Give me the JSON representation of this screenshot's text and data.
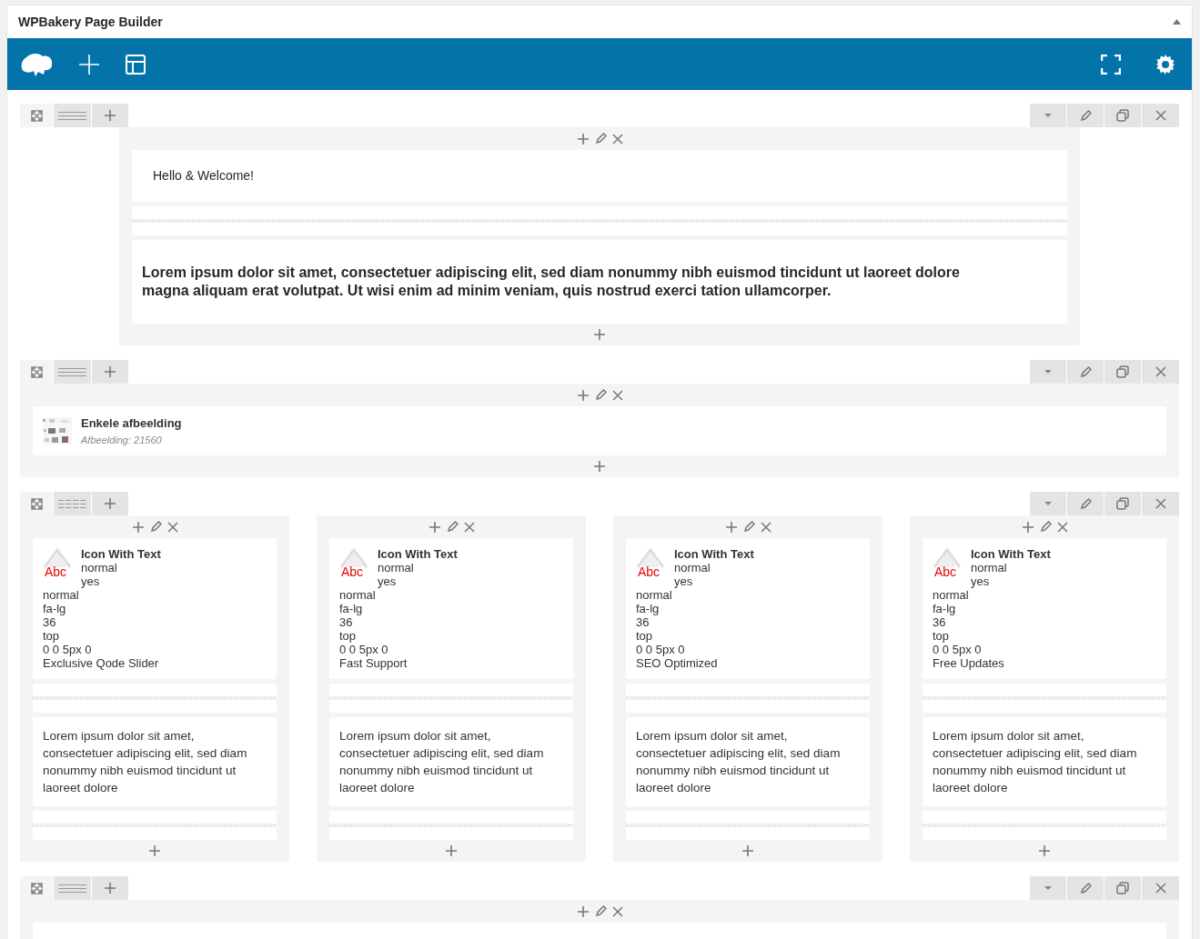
{
  "panel": {
    "title": "WPBakery Page Builder"
  },
  "rows": [
    {
      "offset": true,
      "columns": [
        {
          "elements": [
            {
              "kind": "text",
              "text": "Hello & Welcome!",
              "emphasis": false
            },
            {
              "kind": "separator"
            },
            {
              "kind": "text",
              "text": "Lorem ipsum dolor sit amet, consectetuer adipiscing elit, sed diam nonummy nibh euismod tincidunt ut laoreet dolore magna aliquam erat volutpat. Ut wisi enim ad minim veniam, quis nostrud exerci tation ullamcorper.",
              "emphasis": true
            }
          ]
        }
      ]
    },
    {
      "offset": false,
      "columns": [
        {
          "elements": [
            {
              "title": "Enkele afbeelding",
              "subtitle": "Afbeelding: 21560"
            }
          ]
        }
      ]
    },
    {
      "offset": false,
      "columns": [
        {
          "elements": [
            {
              "kind": "icon_text",
              "title": "Icon With Text",
              "badge": "Abc",
              "lines": [
                "normal",
                "yes",
                "normal",
                "fa-lg",
                "36",
                "top",
                "0 0 5px 0",
                "Exclusive Qode Slider"
              ]
            },
            {
              "kind": "separator"
            },
            {
              "kind": "text",
              "text": "Lorem ipsum dolor sit amet, consectetuer adipiscing elit, sed diam nonummy nibh euismod tincidunt ut laoreet dolore",
              "emphasis": false
            },
            {
              "kind": "separator"
            }
          ]
        },
        {
          "elements": [
            {
              "kind": "icon_text",
              "title": "Icon With Text",
              "badge": "Abc",
              "lines": [
                "normal",
                "yes",
                "normal",
                "fa-lg",
                "36",
                "top",
                "0 0 5px 0",
                "Fast Support"
              ]
            },
            {
              "kind": "separator"
            },
            {
              "kind": "text",
              "text": "Lorem ipsum dolor sit amet, consectetuer adipiscing elit, sed diam nonummy nibh euismod tincidunt ut laoreet dolore",
              "emphasis": false
            },
            {
              "kind": "separator"
            }
          ]
        },
        {
          "elements": [
            {
              "kind": "icon_text",
              "title": "Icon With Text",
              "badge": "Abc",
              "lines": [
                "normal",
                "yes",
                "normal",
                "fa-lg",
                "36",
                "top",
                "0 0 5px 0",
                "SEO Optimized"
              ]
            },
            {
              "kind": "separator"
            },
            {
              "kind": "text",
              "text": "Lorem ipsum dolor sit amet, consectetuer adipiscing elit, sed diam nonummy nibh euismod tincidunt ut laoreet dolore",
              "emphasis": false
            },
            {
              "kind": "separator"
            }
          ]
        },
        {
          "elements": [
            {
              "kind": "icon_text",
              "title": "Icon With Text",
              "badge": "Abc",
              "lines": [
                "normal",
                "yes",
                "normal",
                "fa-lg",
                "36",
                "top",
                "0 0 5px 0",
                "Free Updates"
              ]
            },
            {
              "kind": "separator"
            },
            {
              "kind": "text",
              "text": "Lorem ipsum dolor sit amet, consectetuer adipiscing elit, sed diam nonummy nibh euismod tincidunt ut laoreet dolore",
              "emphasis": false
            },
            {
              "kind": "separator"
            }
          ]
        }
      ]
    },
    {
      "offset": false,
      "columns": [
        {
          "elements": [
            {
              "kind": "empty"
            }
          ]
        }
      ]
    }
  ]
}
